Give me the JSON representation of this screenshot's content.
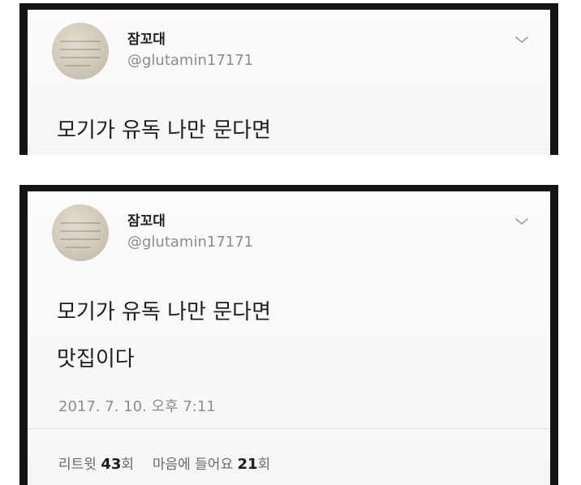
{
  "tweet": {
    "display_name": "잠꼬대",
    "handle": "@glutamin17171",
    "line1": "모기가 유독 나만 문다면",
    "line2": "맛집이다",
    "timestamp": "2017. 7. 10. 오후 7:11",
    "retweet_label": "리트윗",
    "retweet_count": "43",
    "retweet_unit": "회",
    "likes_label": "마음에 들어요",
    "likes_count": "21",
    "likes_unit": "회"
  },
  "icons": {
    "menu": "chevron-down-icon"
  },
  "colors": {
    "frame": "#151515",
    "card": "#f8f8f8",
    "text": "#1e1e1e",
    "muted": "#8d8d8d"
  }
}
